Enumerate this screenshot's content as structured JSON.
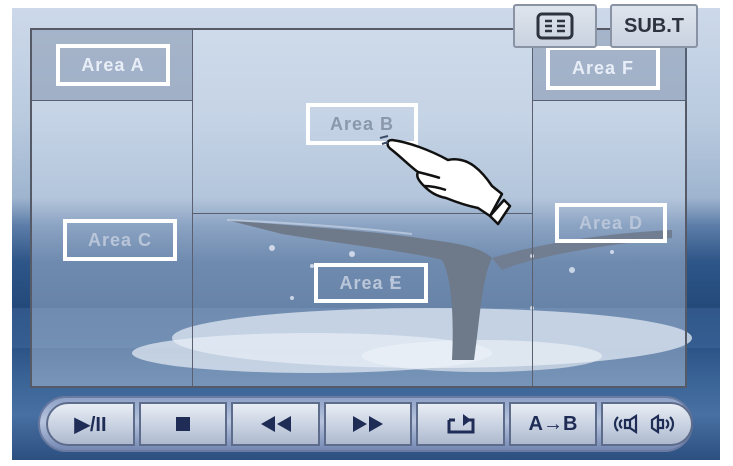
{
  "areas": {
    "a": "Area  A",
    "b": "Area  B",
    "c": "Area  C",
    "d": "Area  D",
    "e": "Area  E",
    "f": "Area  F"
  },
  "top_buttons": {
    "menu_icon": "list-menu-icon",
    "subtitle_label": "SUB.T"
  },
  "controls": [
    {
      "name": "play-pause",
      "label": "▶/II"
    },
    {
      "name": "stop",
      "icon": "stop-icon"
    },
    {
      "name": "rewind",
      "icon": "rewind-icon"
    },
    {
      "name": "fast-forward",
      "icon": "fast-forward-icon"
    },
    {
      "name": "repeat",
      "icon": "repeat-icon"
    },
    {
      "name": "a-b-repeat",
      "label": "A→B"
    },
    {
      "name": "audio",
      "icon": "audio-channel-icon"
    }
  ],
  "pointer": "pointing-hand-icon"
}
